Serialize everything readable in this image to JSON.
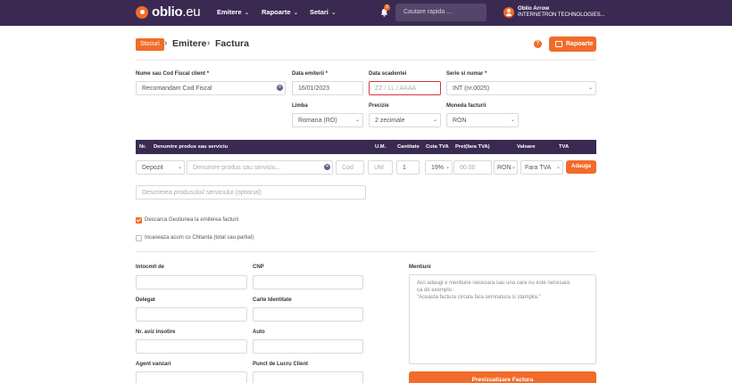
{
  "topbar": {
    "logo_text": "oblio",
    "logo_suffix": ".eu",
    "nav": [
      "Emitere",
      "Rapoarte",
      "Setari"
    ],
    "notification_count": "5",
    "search_placeholder": "Cautare rapida ...",
    "user_name": "Oblio Arrow",
    "user_company": "INTERNETRON TECHNOLOGIES..."
  },
  "breadcrumb": {
    "tag": "Stocuri",
    "level1": "Emitere",
    "level2": "Factura"
  },
  "header_actions": {
    "help": "?",
    "rapoarte_label": "Rapoarte"
  },
  "client": {
    "label": "Nume sau Cod Fiscal client *",
    "value": "Recomandam Cod Fiscal"
  },
  "invoice": {
    "date_issue_label": "Data emiterii *",
    "date_issue_value": "16/01/2023",
    "date_due_label": "Data scadentei",
    "date_due_placeholder": "ZZ / LL / AAAA",
    "series_label": "Serie si numar *",
    "series_value": "INT (nr.0025)",
    "language_label": "Limba",
    "language_value": "Romana (RO)",
    "precision_label": "Precizie",
    "precision_value": "2 zecimale",
    "currency_label": "Moneda facturii",
    "currency_value": "RON"
  },
  "product_table": {
    "headers": [
      "Nr.",
      "Denumire produs sau serviciu",
      "U.M.",
      "Cantitate",
      "Cota TVA",
      "Pret(fara TVA)",
      "Valoare",
      "TVA"
    ],
    "row": {
      "management": "Depozit",
      "name_placeholder": "Denumire produs sau serviciu...",
      "code_placeholder": "Cod",
      "unit_placeholder": "UM",
      "quantity": "1",
      "vat_rate": "19%",
      "price_placeholder": "00.00",
      "currency": "RON",
      "vat_type": "Fara TVA",
      "add_label": "Adauga"
    },
    "description_placeholder": "Descrierea produsului/ serviciului (optional)"
  },
  "options": {
    "discharge_label": "Descarca Gestiunea la emiterea facturii",
    "discharge_checked": true,
    "collect_label": "Incaseaza acum cu Chitanta (total sau partial)",
    "collect_checked": false
  },
  "details": {
    "issued_by_label": "Intocmit de",
    "cnp_label": "CNP",
    "delegate_label": "Delegat",
    "id_card_label": "Carte Identitate",
    "delivery_note_label": "Nr. aviz insotire",
    "vehicle_label": "Auto",
    "sales_agent_label": "Agent vanzari",
    "workplace_label": "Punct de Lucru Client"
  },
  "mentions": {
    "label": "Mentiuni",
    "placeholder_lines": [
      "Aici adaugi o mentiune necesara sau una care nu este necesara",
      "ca de exemplu :",
      "\"Aceasta factura circula fara semnatura si stampila.\""
    ]
  },
  "preview_button": "Previzualizare Factura",
  "colors": {
    "nav_bg": "#3a2a52",
    "accent": "#f26b2a",
    "error": "#d9363e"
  }
}
